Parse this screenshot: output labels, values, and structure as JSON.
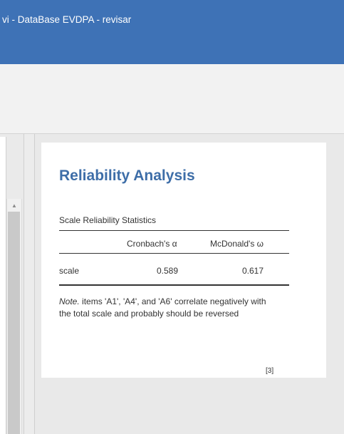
{
  "window": {
    "title": "vi - DataBase EVDPA - revisar"
  },
  "results": {
    "heading": "Reliability Analysis",
    "table": {
      "title": "Scale Reliability Statistics",
      "columns": [
        "",
        "Cronbach's α",
        "McDonald's ω"
      ],
      "rows": [
        {
          "label": "scale",
          "alpha": "0.589",
          "omega": "0.617"
        }
      ]
    },
    "note": {
      "prefix": "Note.",
      "text": " items 'A1', 'A4', and 'A6' correlate negatively with the total scale and probably should be reversed"
    },
    "reference": "[3]"
  },
  "icons": {
    "scroll_up": "chevron-up-icon"
  },
  "colors": {
    "titlebar": "#3e72b6",
    "heading": "#3e6ea8"
  }
}
